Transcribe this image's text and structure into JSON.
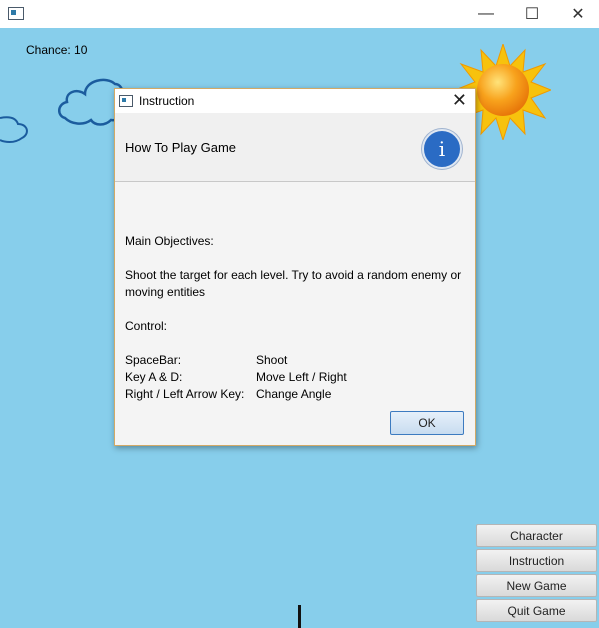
{
  "window": {
    "minimize": "—",
    "maximize": "☐",
    "close": "✕"
  },
  "hud": {
    "chance_text": "Chance: 10"
  },
  "dialog": {
    "title": "Instruction",
    "header": "How To Play Game",
    "objectives_heading": "Main Objectives:",
    "objectives_text": "Shoot the target for each level. Try to avoid a random enemy or moving entities",
    "control_heading": "Control:",
    "controls": [
      {
        "key": "SpaceBar:",
        "action": "Shoot"
      },
      {
        "key": "Key A & D:",
        "action": "Move Left / Right"
      },
      {
        "key": "Right / Left Arrow Key:",
        "action": "Change Angle"
      }
    ],
    "ok_label": "OK",
    "close_glyph": "✕",
    "info_glyph": "i"
  },
  "menu": {
    "character": "Character",
    "instruction": "Instruction",
    "new_game": "New Game",
    "quit_game": "Quit Game"
  },
  "colors": {
    "sky": "#87ceeb",
    "sun": "#f5a800",
    "cloud_outline": "#1b5c9e"
  }
}
